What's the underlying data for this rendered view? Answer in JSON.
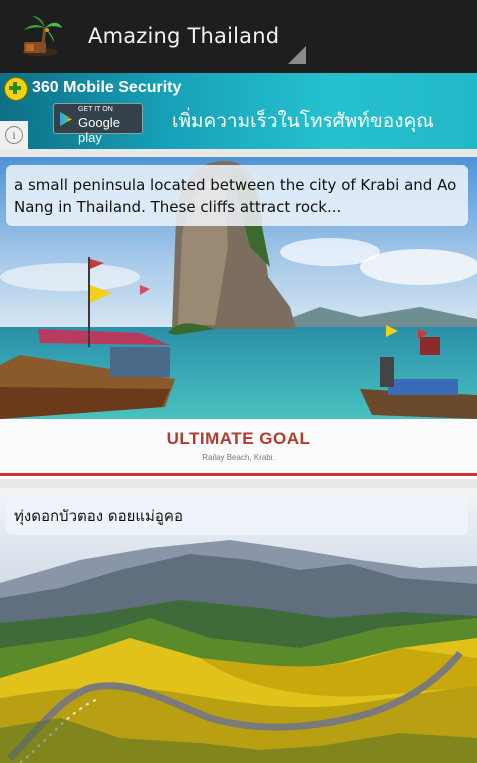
{
  "app": {
    "title": "Amazing Thailand",
    "icon": "palm-tree-island-icon"
  },
  "ad": {
    "brand": "360 Mobile Security",
    "store_badge_top": "GET IT ON",
    "store_badge_main": "Google play",
    "headline": "เพิ่มความเร็วในโทรศัพท์ของคุณ",
    "info_icon": "i"
  },
  "cards": [
    {
      "caption": "a small peninsula located between the city of Krabi and Ao Nang in Thailand. These cliffs attract rock...",
      "image_title": "ULTIMATE GOAL",
      "image_subtitle": "Railay Beach, Krabi."
    },
    {
      "caption": "ทุ่งดอกบัวตอง ดอยแม่อูคอ"
    }
  ],
  "colors": {
    "action_bar": "#1e1e1e",
    "ad_teal": "#17a1b8",
    "accent_red": "#c9392e"
  }
}
